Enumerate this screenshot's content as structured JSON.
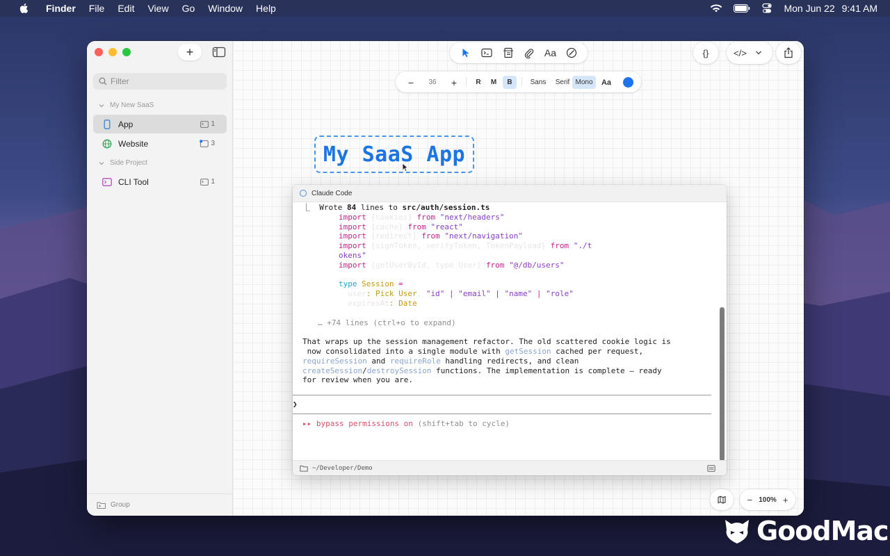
{
  "menubar": {
    "app": "Finder",
    "items": [
      "File",
      "Edit",
      "View",
      "Go",
      "Window",
      "Help"
    ],
    "date": "Mon Jun 22",
    "time": "9:41 AM"
  },
  "sidebar": {
    "add_label": "+",
    "filter_placeholder": "Filter",
    "sections": [
      {
        "label": "My New SaaS"
      },
      {
        "label": "Side Project"
      }
    ],
    "items": [
      {
        "label": "App",
        "count": "1",
        "icon": "phone-icon"
      },
      {
        "label": "Website",
        "count": "3",
        "icon": "globe-icon"
      },
      {
        "label": "CLI Tool",
        "count": "1",
        "icon": "terminal-icon"
      }
    ],
    "footer_label": "Group"
  },
  "format_bar": {
    "minus": "−",
    "size": "36",
    "plus": "+",
    "weights": [
      "R",
      "M",
      "B"
    ],
    "families": [
      "Sans",
      "Serif",
      "Mono"
    ],
    "case_label": "Aa",
    "selected_weight": "B",
    "selected_family": "Mono",
    "color": "#1b74f0"
  },
  "tools": {
    "text_tool": "Aa",
    "json_label": "{}",
    "code_label": "</>"
  },
  "canvas": {
    "title_text": "My SaaS App"
  },
  "terminal": {
    "title": "Claude Code",
    "wrote_prefix": "Wrote ",
    "wrote_count": "84",
    "wrote_mid": " lines to ",
    "wrote_file": "src/auth/session.ts",
    "code": {
      "kw_import": "import",
      "kw_from": "from",
      "mod1": "\"next/headers\"",
      "mod2": "\"react\"",
      "mod3": "\"next/navigation\"",
      "mod4a": "\"./t",
      "mod4b": "okens\"",
      "mod5": "\"@/db/users\"",
      "type_kw": "type",
      "type_name": "Session",
      "eq": " =",
      "pick": ": Pick",
      "user": " User",
      "f_id": "\"id\"",
      "f_email": "\"email\"",
      "f_name": "\"name\"",
      "f_role": "\"role\"",
      "pipe": " | ",
      "date_colon": ": ",
      "date": "Date"
    },
    "expand": "… +74 lines (ctrl+o to expand)",
    "summary": {
      "l1": "That wraps up the session management refactor. The old scattered cookie logic is",
      "l2a": " now consolidated into a single module with ",
      "l2b": "getSession",
      "l2c": " cached per request,",
      "l3a": "requireSession",
      "l3b": " and ",
      "l3c": "requireRole",
      "l3d": " handling redirects, and clean",
      "l4a": "createSession",
      "l4b": "/",
      "l4c": "destroySession",
      "l4d": " functions. The implementation is complete — ready",
      "l5": "for review when you are."
    },
    "prompt": "❯",
    "mode_arrows": "▸▸",
    "mode_text": "bypass permissions on",
    "mode_hint": " (shift+tab to cycle)",
    "cwd": "~/Developer/Demo"
  },
  "zoom": {
    "minus": "−",
    "value": "100%",
    "plus": "+"
  },
  "watermark": {
    "text": "GoodMac"
  }
}
